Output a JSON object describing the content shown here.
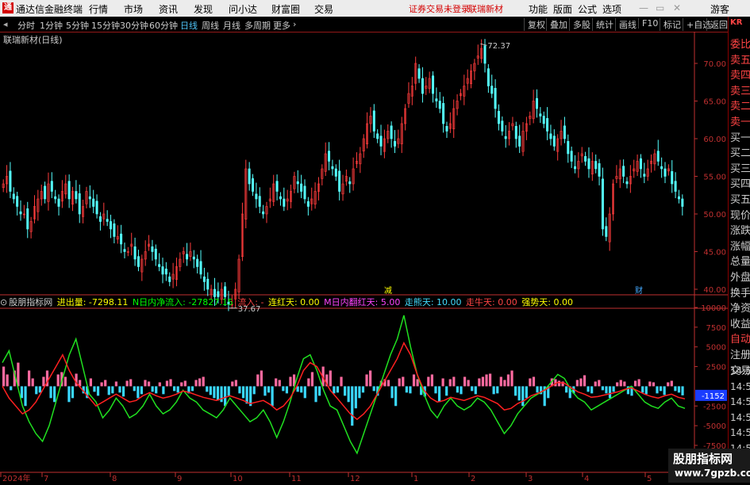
{
  "menubar": {
    "app_title": "通达信金融终端",
    "logo": "通",
    "menus": [
      "行情",
      "市场",
      "资讯",
      "发现",
      "问小达",
      "财富圈",
      "交易"
    ],
    "notice": "证券交易未登录",
    "stock_name": "联瑞新材",
    "right_menus": [
      "功能",
      "版面",
      "公式",
      "选项"
    ],
    "user": "游客"
  },
  "toolbar": {
    "periods": [
      "分时",
      "1分钟",
      "5分钟",
      "15分钟",
      "30分钟",
      "60分钟",
      "日线",
      "周线",
      "月线",
      "多周期",
      "更多"
    ],
    "active_period": "日线",
    "right_buttons": [
      "复权",
      "叠加",
      "多股",
      "统计",
      "画线",
      "F10",
      "标记",
      "+自选",
      "返回"
    ]
  },
  "right_panel": {
    "code": "KR",
    "items": [
      "委比",
      "卖五",
      "卖四",
      "卖三",
      "卖二",
      "卖一",
      "买一",
      "买二",
      "买三",
      "买四",
      "买五",
      "现价",
      "涨跌",
      "涨幅",
      "总量",
      "外盘",
      "换手",
      "净资",
      "收益",
      "自动",
      "注册",
      "交易",
      "14:55",
      "14:55",
      "14:55",
      "14:56",
      "14:56",
      "14:56",
      "14:56",
      "14:56"
    ]
  },
  "main_chart": {
    "title": "联瑞新材(日线)",
    "high_label": "72.37",
    "low_label": "37.67",
    "markers": [
      "减",
      "财"
    ],
    "y_ticks": [
      "70.00",
      "65.00",
      "60.00",
      "55.00",
      "50.00",
      "45.00",
      "40.00"
    ]
  },
  "indicator": {
    "name": "股朋指标网",
    "fields": [
      {
        "label": "进出量:",
        "value": "-7298.11",
        "color": "#ffff00"
      },
      {
        "label": "N日内净流入:",
        "value": "-27827.15",
        "color": "#00ff00"
      },
      {
        "label": "流入:",
        "value": "-",
        "color": "#ff4444"
      },
      {
        "label": "连红天:",
        "value": "0.00",
        "color": "#ffff00"
      },
      {
        "label": "M日内翻红天:",
        "value": "5.00",
        "color": "#ff44ff"
      },
      {
        "label": "走熊天:",
        "value": "10.00",
        "color": "#44ddff"
      },
      {
        "label": "走牛天:",
        "value": "0.00",
        "color": "#ff4444"
      },
      {
        "label": "强势天:",
        "value": "0.00",
        "color": "#ffff00"
      }
    ],
    "y_ticks": [
      "10000",
      "7500",
      "5000",
      "2500",
      "-2500",
      "-5000",
      "-7500"
    ],
    "current_value": "-1152"
  },
  "x_axis": {
    "labels": [
      "2024年",
      "7",
      "8",
      "9",
      "10",
      "11",
      "12",
      "1",
      "2",
      "3",
      "4",
      "5"
    ]
  },
  "watermark": {
    "line1": "股朋指标网",
    "line2": "www.7gpzb.com"
  },
  "colors": {
    "up": "#ff3c3c",
    "down": "#54ffff",
    "axis_red": "#c03030",
    "panel_bg": "#000000"
  }
}
